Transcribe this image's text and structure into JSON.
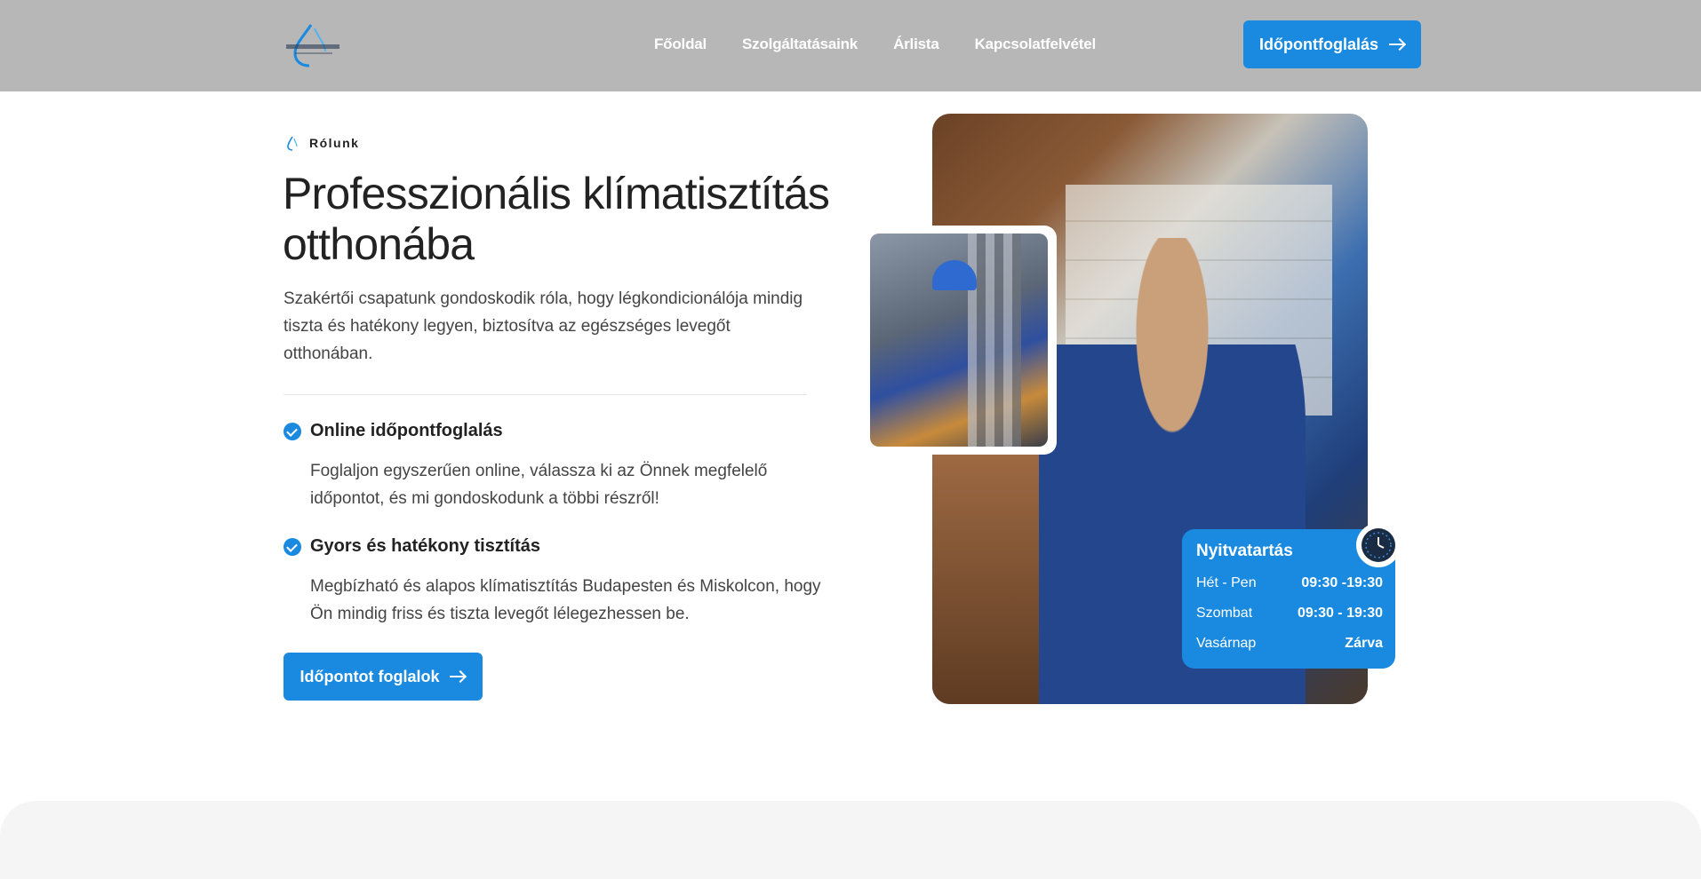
{
  "header": {
    "nav": [
      "Főoldal",
      "Szolgáltatásaink",
      "Árlista",
      "Kapcsolatfelvétel"
    ],
    "cta_label": "Időpontfoglalás"
  },
  "about": {
    "eyebrow": "Rólunk",
    "heading": "Professzionális klímatisztítás otthonába",
    "lead": "Szakértői csapatunk gondoskodik róla, hogy légkondicionálója mindig tiszta és hatékony legyen, biztosítva az egészséges levegőt otthonában.",
    "features": [
      {
        "title": "Online időpontfoglalás",
        "desc": "Foglaljon egyszerűen online, válassza ki az Önnek megfelelő időpontot, és mi gondoskodunk a többi részről!"
      },
      {
        "title": "Gyors és hatékony tisztítás",
        "desc": "Megbízható és alapos klímatisztítás Budapesten és Miskolcon, hogy Ön mindig friss és tiszta levegőt lélegezhessen be."
      }
    ],
    "cta_label": "Időpontot foglalok"
  },
  "hours": {
    "title": "Nyitvatartás",
    "rows": [
      {
        "day": "Hét - Pen",
        "time": "09:30 -19:30"
      },
      {
        "day": "Szombat",
        "time": "09:30 - 19:30"
      },
      {
        "day": "Vasárnap",
        "time": "Zárva"
      }
    ]
  },
  "colors": {
    "accent": "#1a8ae0",
    "header_bg": "#b7b7b7"
  },
  "icons": [
    "logo-drop-icon",
    "arrow-right-icon",
    "check-circle-icon",
    "clock-icon"
  ]
}
